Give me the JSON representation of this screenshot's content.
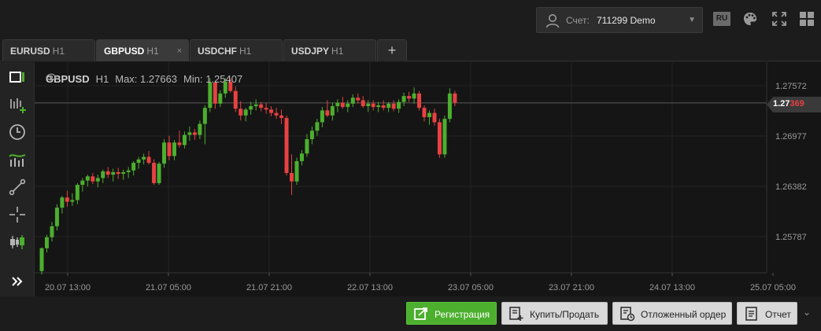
{
  "account": {
    "label": "Счет:",
    "value": "711299 Demo"
  },
  "language": "RU",
  "tabs": [
    {
      "symbol": "EURUSD",
      "tf": "H1"
    },
    {
      "symbol": "GBPUSD",
      "tf": "H1",
      "close": "×"
    },
    {
      "symbol": "USDCHF",
      "tf": "H1"
    },
    {
      "symbol": "USDJPY",
      "tf": "H1"
    }
  ],
  "tab_add": "+",
  "legend": {
    "symbol": "GBPUSD",
    "tf": "H1",
    "max": "Max: 1.27663",
    "min": "Min: 1.25407"
  },
  "price_tag": {
    "main": "1.27",
    "pips": "369"
  },
  "chart_data": {
    "type": "candlestick",
    "y_ticks": [
      "1.27572",
      "1.26977",
      "1.26382",
      "1.25787"
    ],
    "x_ticks": [
      "20.07 13:00",
      "21.07 05:00",
      "21.07 21:00",
      "22.07 13:00",
      "23.07 05:00",
      "23.07 21:00",
      "24.07 13:00",
      "25.07 05:00"
    ],
    "current_price": 1.27369,
    "max": 1.27663,
    "min": 1.25407,
    "up_color": "#4caf2e",
    "down_color": "#e84141",
    "candles": [
      [
        1.2538,
        1.2566,
        1.2534,
        1.2565
      ],
      [
        1.2565,
        1.2581,
        1.256,
        1.2578
      ],
      [
        1.2578,
        1.2596,
        1.2573,
        1.2591
      ],
      [
        1.2591,
        1.2617,
        1.2586,
        1.2613
      ],
      [
        1.2613,
        1.2627,
        1.2606,
        1.2625
      ],
      [
        1.2625,
        1.2633,
        1.2614,
        1.262
      ],
      [
        1.262,
        1.263,
        1.2615,
        1.2622
      ],
      [
        1.2622,
        1.2642,
        1.2617,
        1.264
      ],
      [
        1.264,
        1.2648,
        1.2632,
        1.2645
      ],
      [
        1.2645,
        1.2652,
        1.2638,
        1.265
      ],
      [
        1.265,
        1.2654,
        1.2641,
        1.2644
      ],
      [
        1.2644,
        1.2652,
        1.2637,
        1.2648
      ],
      [
        1.2648,
        1.2658,
        1.2642,
        1.2656
      ],
      [
        1.2656,
        1.2661,
        1.2648,
        1.2652
      ],
      [
        1.2652,
        1.2659,
        1.2644,
        1.2655
      ],
      [
        1.2655,
        1.266,
        1.2647,
        1.2653
      ],
      [
        1.2653,
        1.2658,
        1.2646,
        1.2655
      ],
      [
        1.2655,
        1.2661,
        1.2648,
        1.2657
      ],
      [
        1.2657,
        1.2668,
        1.2651,
        1.2666
      ],
      [
        1.2666,
        1.2673,
        1.2659,
        1.267
      ],
      [
        1.267,
        1.2677,
        1.2664,
        1.2673
      ],
      [
        1.2673,
        1.268,
        1.2664,
        1.2666
      ],
      [
        1.2666,
        1.267,
        1.264,
        1.2642
      ],
      [
        1.2642,
        1.2667,
        1.264,
        1.2665
      ],
      [
        1.2665,
        1.2694,
        1.266,
        1.269
      ],
      [
        1.269,
        1.2698,
        1.2669,
        1.2674
      ],
      [
        1.2674,
        1.2693,
        1.2669,
        1.269
      ],
      [
        1.269,
        1.2704,
        1.2684,
        1.2687
      ],
      [
        1.2687,
        1.2703,
        1.2683,
        1.2699
      ],
      [
        1.2699,
        1.2709,
        1.2692,
        1.2702
      ],
      [
        1.2702,
        1.2706,
        1.2693,
        1.2699
      ],
      [
        1.2699,
        1.2716,
        1.2694,
        1.2712
      ],
      [
        1.2712,
        1.2734,
        1.2688,
        1.2731
      ],
      [
        1.2731,
        1.2766,
        1.2726,
        1.2761
      ],
      [
        1.2761,
        1.2763,
        1.273,
        1.2736
      ],
      [
        1.2736,
        1.2752,
        1.2732,
        1.2748
      ],
      [
        1.2748,
        1.2766,
        1.2743,
        1.2762
      ],
      [
        1.2762,
        1.2766,
        1.2749,
        1.2751
      ],
      [
        1.2751,
        1.2756,
        1.2726,
        1.273
      ],
      [
        1.273,
        1.2739,
        1.2716,
        1.2722
      ],
      [
        1.2722,
        1.2731,
        1.2715,
        1.2729
      ],
      [
        1.2729,
        1.2738,
        1.2723,
        1.2733
      ],
      [
        1.2733,
        1.2741,
        1.2728,
        1.2735
      ],
      [
        1.2735,
        1.2738,
        1.2727,
        1.2731
      ],
      [
        1.2731,
        1.2737,
        1.2724,
        1.2729
      ],
      [
        1.2729,
        1.2733,
        1.2721,
        1.2725
      ],
      [
        1.2725,
        1.2731,
        1.2718,
        1.2722
      ],
      [
        1.2722,
        1.2729,
        1.2712,
        1.2719
      ],
      [
        1.2719,
        1.2722,
        1.2651,
        1.2654
      ],
      [
        1.2654,
        1.2676,
        1.2628,
        1.2644
      ],
      [
        1.2644,
        1.2672,
        1.264,
        1.2668
      ],
      [
        1.2668,
        1.2681,
        1.2663,
        1.2677
      ],
      [
        1.2677,
        1.27,
        1.2673,
        1.2694
      ],
      [
        1.2694,
        1.2709,
        1.2688,
        1.2704
      ],
      [
        1.2704,
        1.2718,
        1.2698,
        1.2714
      ],
      [
        1.2714,
        1.2732,
        1.2708,
        1.2728
      ],
      [
        1.2728,
        1.274,
        1.272,
        1.2722
      ],
      [
        1.2722,
        1.2737,
        1.2716,
        1.2733
      ],
      [
        1.2733,
        1.2741,
        1.2726,
        1.2737
      ],
      [
        1.2737,
        1.2744,
        1.273,
        1.2732
      ],
      [
        1.2732,
        1.274,
        1.2726,
        1.2736
      ],
      [
        1.2736,
        1.2747,
        1.2732,
        1.2743
      ],
      [
        1.2743,
        1.2748,
        1.2736,
        1.274
      ],
      [
        1.274,
        1.2745,
        1.2731,
        1.2733
      ],
      [
        1.2733,
        1.274,
        1.2726,
        1.2736
      ],
      [
        1.2736,
        1.274,
        1.2728,
        1.2732
      ],
      [
        1.2732,
        1.2738,
        1.2726,
        1.2734
      ],
      [
        1.2734,
        1.274,
        1.2728,
        1.2731
      ],
      [
        1.2731,
        1.2738,
        1.2726,
        1.2736
      ],
      [
        1.2736,
        1.274,
        1.2727,
        1.273
      ],
      [
        1.273,
        1.2741,
        1.2725,
        1.2738
      ],
      [
        1.2738,
        1.2749,
        1.2733,
        1.2745
      ],
      [
        1.2745,
        1.275,
        1.2738,
        1.2742
      ],
      [
        1.2742,
        1.2755,
        1.2736,
        1.2748
      ],
      [
        1.2748,
        1.2751,
        1.2728,
        1.2731
      ],
      [
        1.2731,
        1.2734,
        1.2715,
        1.272
      ],
      [
        1.272,
        1.2728,
        1.2711,
        1.2725
      ],
      [
        1.2725,
        1.273,
        1.271,
        1.2714
      ],
      [
        1.2714,
        1.2718,
        1.2672,
        1.2676
      ],
      [
        1.2676,
        1.2722,
        1.2672,
        1.2718
      ],
      [
        1.2718,
        1.2754,
        1.2714,
        1.2748
      ],
      [
        1.2748,
        1.2751,
        1.2733,
        1.2737
      ]
    ]
  },
  "buttons": {
    "register": "Регистрация",
    "buy_sell": "Купить/Продать",
    "pending": "Отложенный ордер",
    "report": "Отчет"
  },
  "expand": "⌄"
}
